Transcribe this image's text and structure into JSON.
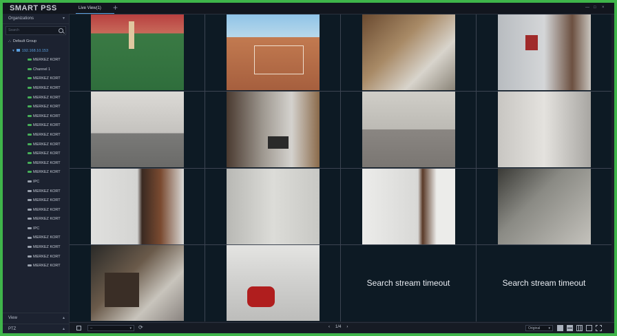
{
  "app": {
    "title": "SMART PSS"
  },
  "tabs": [
    {
      "label": "Live View(1)"
    }
  ],
  "sidebar": {
    "header": "Organizations",
    "search_placeholder": "Search",
    "group": "Default Group",
    "device": "192.168.10.153",
    "channels": [
      {
        "label": "MERKEZ KORT",
        "icon": "camera-online-icon"
      },
      {
        "label": "Channel 1",
        "icon": "camera-online-icon"
      },
      {
        "label": "MERKEZ KORT",
        "icon": "camera-online-icon"
      },
      {
        "label": "MERKEZ KORT",
        "icon": "camera-online-icon"
      },
      {
        "label": "MERKEZ KORT",
        "icon": "camera-online-icon"
      },
      {
        "label": "MERKEZ KORT",
        "icon": "camera-online-icon"
      },
      {
        "label": "MERKEZ KORT",
        "icon": "camera-online-icon"
      },
      {
        "label": "MERKEZ KORT",
        "icon": "camera-online-icon"
      },
      {
        "label": "MERKEZ KORT",
        "icon": "camera-online-icon"
      },
      {
        "label": "MERKEZ KORT",
        "icon": "camera-online-icon"
      },
      {
        "label": "MERKEZ KORT",
        "icon": "camera-online-icon"
      },
      {
        "label": "MERKEZ KORT",
        "icon": "camera-online-icon"
      },
      {
        "label": "MERKEZ KORT",
        "icon": "camera-online-icon"
      },
      {
        "label": "IPC",
        "icon": "camera-offline-icon"
      },
      {
        "label": "MERKEZ KORT",
        "icon": "camera-offline-icon"
      },
      {
        "label": "MERKEZ KORT",
        "icon": "camera-offline-icon"
      },
      {
        "label": "MERKEZ KORT",
        "icon": "camera-offline-icon"
      },
      {
        "label": "MERKEZ KORT",
        "icon": "camera-offline-icon"
      },
      {
        "label": "IPC",
        "icon": "camera-offline-icon"
      },
      {
        "label": "MERKEZ KORT",
        "icon": "camera-offline-icon"
      },
      {
        "label": "MERKEZ KORT",
        "icon": "camera-offline-icon"
      },
      {
        "label": "MERKEZ KORT",
        "icon": "camera-offline-icon"
      },
      {
        "label": "MERKEZ KORT",
        "icon": "camera-offline-icon"
      }
    ],
    "footer": [
      {
        "label": "View"
      },
      {
        "label": "PTZ"
      }
    ]
  },
  "video_grid": {
    "timeout_message": "Search stream timeout",
    "cells": [
      {
        "scene": "tennis-court",
        "status": "live"
      },
      {
        "scene": "tennis-court-aerial",
        "status": "live"
      },
      {
        "scene": "office",
        "status": "live"
      },
      {
        "scene": "corridor",
        "status": "live"
      },
      {
        "scene": "room",
        "status": "live"
      },
      {
        "scene": "hall",
        "status": "live"
      },
      {
        "scene": "room",
        "status": "live"
      },
      {
        "scene": "room",
        "status": "live"
      },
      {
        "scene": "doorway",
        "status": "live"
      },
      {
        "scene": "hall",
        "status": "live"
      },
      {
        "scene": "doorway",
        "status": "live"
      },
      {
        "scene": "room",
        "status": "live"
      },
      {
        "scene": "cafe",
        "status": "live"
      },
      {
        "scene": "corridor",
        "status": "live"
      },
      {
        "scene": "",
        "status": "timeout"
      },
      {
        "scene": "",
        "status": "timeout"
      }
    ]
  },
  "bottom_bar": {
    "stream_select": "--",
    "page_indicator": "1/4",
    "ratio_select": "Original"
  },
  "colors": {
    "frame_green": "#3fb54a",
    "panel_bg": "#1c2230",
    "accent_blue": "#5aa0e0",
    "online_green": "#46b058"
  }
}
